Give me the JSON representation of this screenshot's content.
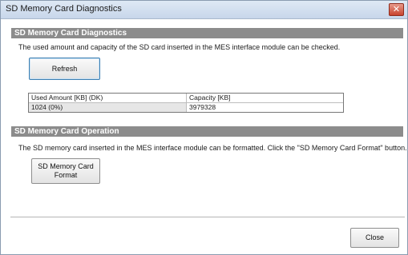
{
  "window": {
    "title": "SD Memory Card Diagnostics",
    "close_glyph": "✕"
  },
  "diagnostics": {
    "heading": "SD Memory Card Diagnostics",
    "description": "The used amount and capacity of the SD card inserted in the MES interface module can be checked.",
    "refresh_label": "Refresh",
    "table": {
      "headers": [
        "Used Amount [KB] (DK)",
        "Capacity [KB]"
      ],
      "rows": [
        [
          "1024 (0%)",
          "3979328"
        ]
      ]
    }
  },
  "operation": {
    "heading": "SD Memory Card Operation",
    "description": "The SD memory card inserted in the MES interface module can be formatted. Click the \"SD Memory Card Format\" button.",
    "format_label_line1": "SD Memory Card",
    "format_label_line2": "Format"
  },
  "footer": {
    "close_label": "Close"
  },
  "colors": {
    "section_header": "#8c8c8c",
    "focus_border": "#3c7fb1",
    "close_button": "#c8432e"
  }
}
